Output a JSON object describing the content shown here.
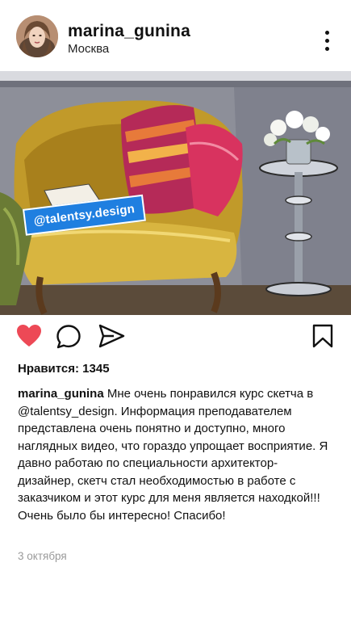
{
  "post": {
    "username": "marina_gunina",
    "location": "Москва",
    "tag_label": "@talentsy.design",
    "likes_text": "Нравится: 1345",
    "caption_user": "marina_gunina",
    "caption_text": " Мне очень понравился курс скетча в @talentsy_design. Информация преподавателем представлена очень понятно и доступно, много наглядных видео, что гораздо упрощает восприятие. Я давно работаю по специальности архитектор-дизайнер, скетч стал необходимостью в работе с заказчиком и этот курс для меня является находкой!!! Очень было бы интересно! Спасибо!",
    "date": "3 октября"
  },
  "icons": {
    "like": "heart-icon",
    "comment": "comment-icon",
    "share": "send-icon",
    "save": "bookmark-icon",
    "more": "more-vertical-icon"
  },
  "colors": {
    "like_active": "#ed4956",
    "tag_bg": "#1f7fe0"
  }
}
